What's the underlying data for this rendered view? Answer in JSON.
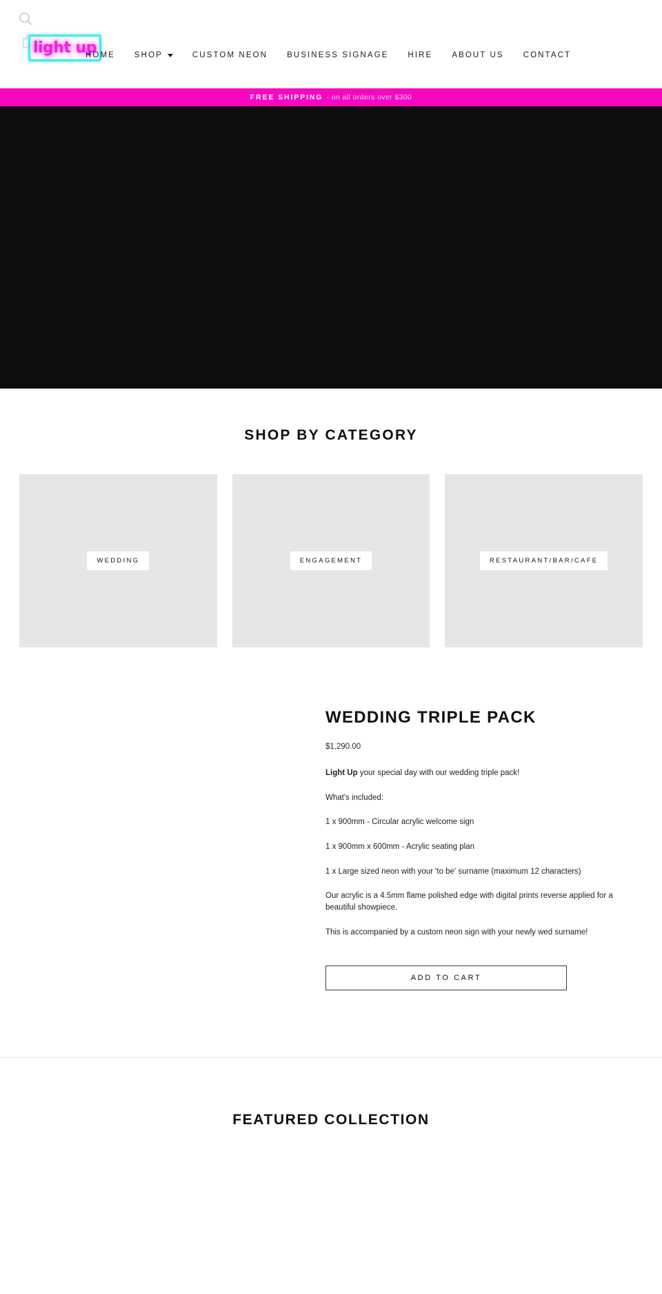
{
  "header": {
    "search_icon": "search-icon",
    "cart_icon": "cart-icon",
    "logo_text": "light up",
    "logo_border_color": "#46e8f0",
    "logo_text_color": "#f020e0",
    "nav": [
      {
        "label": "HOME",
        "has_caret": false
      },
      {
        "label": "SHOP",
        "has_caret": true
      },
      {
        "label": "CUSTOM NEON",
        "has_caret": false
      },
      {
        "label": "BUSINESS SIGNAGE",
        "has_caret": false
      },
      {
        "label": "HIRE",
        "has_caret": false
      },
      {
        "label": "ABOUT US",
        "has_caret": false
      },
      {
        "label": "CONTACT",
        "has_caret": false
      }
    ]
  },
  "announcement": {
    "strong": "FREE SHIPPING",
    "rest": "- on all orders over $300",
    "background": "#f708c0"
  },
  "hero": {
    "background": "#0e0e0f"
  },
  "category_section": {
    "title": "SHOP BY CATEGORY",
    "tiles": [
      {
        "label": "WEDDING"
      },
      {
        "label": "ENGAGEMENT"
      },
      {
        "label": "RESTAURANT/BAR/CAFE"
      }
    ]
  },
  "product": {
    "title": "WEDDING TRIPLE PACK",
    "price": "$1,290.00",
    "desc_lead_strong": "Light Up",
    "desc_lead_rest": " your special day with our wedding triple pack!",
    "desc_lines": [
      "What's included:",
      "1 x 900mm - Circular acrylic welcome sign",
      "1 x 900mm x 600mm - Acrylic seating plan",
      "1 x Large sized neon with your 'to be' surname (maximum 12 characters)",
      "Our acrylic is a 4.5mm flame polished edge with digital prints reverse applied for a beautiful showpiece.",
      "This is accompanied by a custom neon sign with your newly wed surname!"
    ],
    "add_to_cart_label": "ADD TO CART"
  },
  "featured": {
    "title": "FEATURED COLLECTION"
  }
}
